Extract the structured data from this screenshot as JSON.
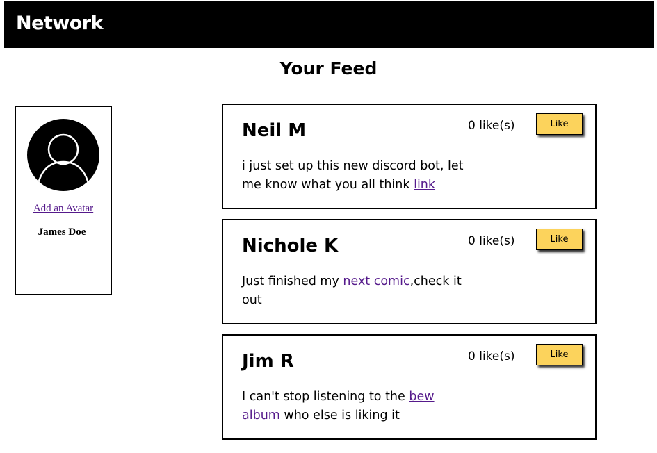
{
  "header": {
    "brand": "Network"
  },
  "feed": {
    "title": "Your Feed"
  },
  "profile": {
    "add_avatar_link": "Add an Avatar",
    "name": "James Doe",
    "avatar_icon": "default-user-avatar-icon"
  },
  "posts": [
    {
      "author": "Neil M",
      "likes": "0 like(s)",
      "like_label": "Like",
      "text_before": "i just set up this new discord bot, let me know what you all think ",
      "link_text": "link",
      "text_after": ""
    },
    {
      "author": "Nichole K",
      "likes": "0 like(s)",
      "like_label": "Like",
      "text_before": "Just finished my ",
      "link_text": "next comic",
      "text_after": ",check it out"
    },
    {
      "author": "Jim R",
      "likes": "0 like(s)",
      "like_label": "Like",
      "text_before": "I can't stop listening to the ",
      "link_text": "bew album",
      "text_after": " who else is liking it"
    }
  ],
  "colors": {
    "header_bg": "#000000",
    "like_button": "#fcd35c",
    "link": "#551a8b"
  }
}
